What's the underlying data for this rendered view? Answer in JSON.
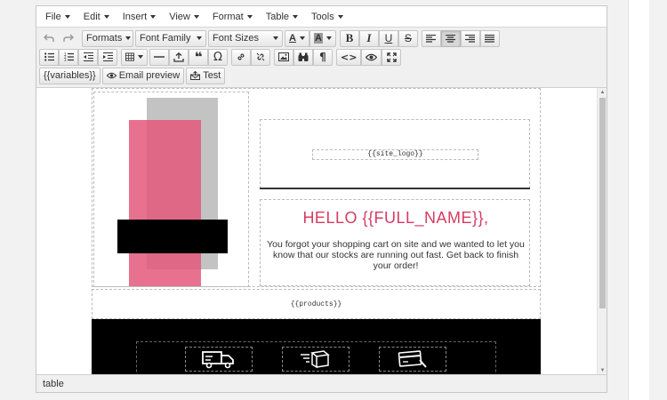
{
  "menubar": {
    "items": [
      "File",
      "Edit",
      "Insert",
      "View",
      "Format",
      "Table",
      "Tools"
    ]
  },
  "toolbar1": {
    "undo_icon": "undo-icon",
    "redo_icon": "redo-icon",
    "formats_label": "Formats",
    "font_family_label": "Font Family",
    "font_sizes_label": "Font Sizes",
    "text_color_glyph": "A",
    "bg_color_glyph": "A",
    "bold_glyph": "B",
    "italic_glyph": "I",
    "underline_glyph": "U",
    "strike_glyph": "S"
  },
  "toolbar3": {
    "variables_label": "{{variables}}",
    "email_preview_label": "Email preview",
    "test_label": "Test"
  },
  "content": {
    "site_logo": "{{site_logo}}",
    "greeting": "HELLO {{FULL_NAME}},",
    "message": "You forgot your shopping cart on site and we wanted to let you know that our stocks are running out fast. Get back to finish your order!",
    "products": "{{products}}"
  },
  "colors": {
    "greeting": "#d73b63",
    "pink_block": "#e3587b",
    "gray_block": "#c3c3c3",
    "footer": "#000000"
  },
  "statusbar": {
    "path": "table"
  }
}
